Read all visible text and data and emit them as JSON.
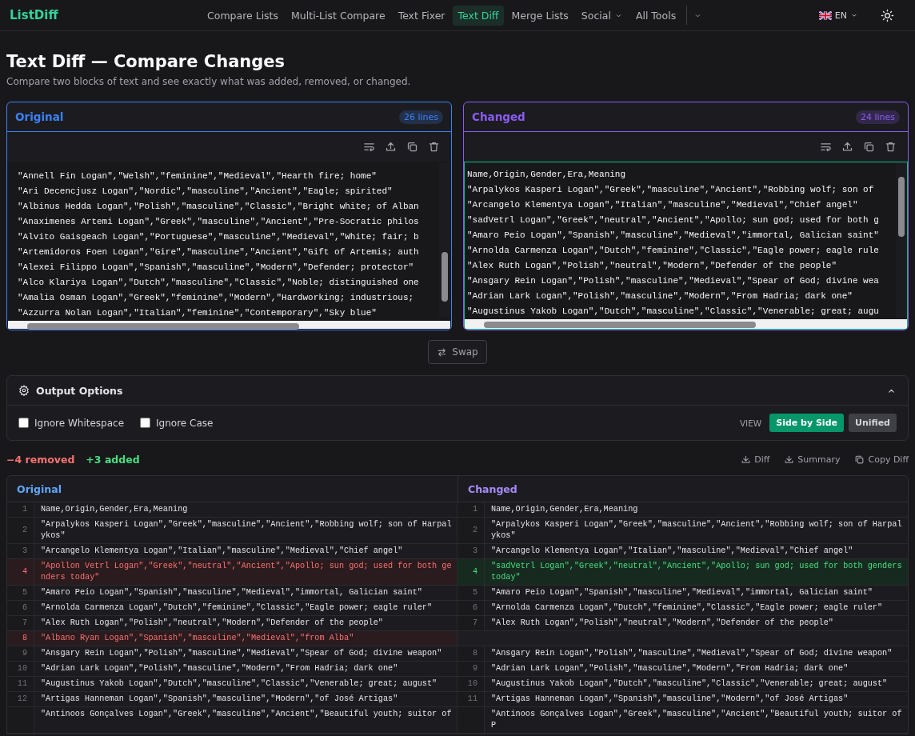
{
  "nav": {
    "brand": "ListDiff",
    "links": [
      {
        "label": "Compare Lists",
        "selected": false,
        "dropdown": false
      },
      {
        "label": "Multi-List Compare",
        "selected": false,
        "dropdown": false
      },
      {
        "label": "Text Fixer",
        "selected": false,
        "dropdown": false
      },
      {
        "label": "Text Diff",
        "selected": true,
        "dropdown": false
      },
      {
        "label": "Merge Lists",
        "selected": false,
        "dropdown": false
      },
      {
        "label": "Social",
        "selected": false,
        "dropdown": true
      },
      {
        "label": "All Tools",
        "selected": false,
        "dropdown": false
      }
    ],
    "language": "EN"
  },
  "page": {
    "title": "Text Diff — Compare Changes",
    "subtitle": "Compare two blocks of text and see exactly what was added, removed, or changed."
  },
  "editors": [
    {
      "title": "Original",
      "count": "26 lines",
      "color": "#3b82f6",
      "focused": false,
      "lines": [
        "\"Annell Fin Logan\",\"Welsh\",\"feminine\",\"Medieval\",\"Hearth fire; home\"",
        "\"Ari Decencjusz Logan\",\"Nordic\",\"masculine\",\"Ancient\",\"Eagle; spirited\"",
        "\"Albinus Hedda Logan\",\"Polish\",\"masculine\",\"Classic\",\"Bright white; of Alban",
        "\"Anaximenes Artemi Logan\",\"Greek\",\"masculine\",\"Ancient\",\"Pre-Socratic philos",
        "\"Alvito Gaisgeach Logan\",\"Portuguese\",\"masculine\",\"Medieval\",\"White; fair; b",
        "\"Artemidoros Foen Logan\",\"Gire\",\"masculine\",\"Ancient\",\"Gift of Artemis; auth",
        "\"Alexei Filippo Logan\",\"Spanish\",\"masculine\",\"Modern\",\"Defender; protector\"",
        "\"Alco Klariya Logan\",\"Dutch\",\"masculine\",\"Classic\",\"Noble; distinguished one",
        "\"Amalia Osman Logan\",\"Greek\",\"feminine\",\"Modern\",\"Hardworking; industrious;",
        "\"Azzurra Nolan Logan\",\"Italian\",\"feminine\",\"Contemporary\",\"Sky blue\""
      ]
    },
    {
      "title": "Changed",
      "count": "24 lines",
      "color": "#8b5cf6",
      "focused": true,
      "lines": [
        "Name,Origin,Gender,Era,Meaning",
        "\"Arpalykos Kasperi Logan\",\"Greek\",\"masculine\",\"Ancient\",\"Robbing wolf; son of",
        "\"Arcangelo Klementya Logan\",\"Italian\",\"masculine\",\"Medieval\",\"Chief angel\"",
        "\"sadVetrl Logan\",\"Greek\",\"neutral\",\"Ancient\",\"Apollo; sun god; used for both g",
        "\"Amaro Peio Logan\",\"Spanish\",\"masculine\",\"Medieval\",\"immortal, Galician saint\"",
        "\"Arnolda Carmenza Logan\",\"Dutch\",\"feminine\",\"Classic\",\"Eagle power; eagle rule",
        "\"Alex Ruth Logan\",\"Polish\",\"neutral\",\"Modern\",\"Defender of the people\"",
        "\"Ansgary Rein Logan\",\"Polish\",\"masculine\",\"Medieval\",\"Spear of God; divine wea",
        "\"Adrian Lark Logan\",\"Polish\",\"masculine\",\"Modern\",\"From Hadria; dark one\"",
        "\"Augustinus Yakob Logan\",\"Dutch\",\"masculine\",\"Classic\",\"Venerable; great; augu"
      ]
    }
  ],
  "swap": "Swap",
  "options": {
    "title": "Output Options",
    "expanded": true,
    "checkboxes": [
      {
        "label": "Ignore Whitespace",
        "checked": false
      },
      {
        "label": "Ignore Case",
        "checked": false
      }
    ],
    "view_label": "VIEW",
    "views": [
      {
        "label": "Side by Side",
        "selected": true
      },
      {
        "label": "Unified",
        "selected": false
      }
    ]
  },
  "summary": {
    "removed": "−4 removed",
    "added": "+3 added",
    "actions": [
      {
        "label": "Diff",
        "kind": "download"
      },
      {
        "label": "Summary",
        "kind": "download"
      },
      {
        "label": "Copy Diff",
        "kind": "copy"
      }
    ]
  },
  "diff": {
    "columns": [
      {
        "title": "Original",
        "color": "#60a5fa"
      },
      {
        "title": "Changed",
        "color": "#a78bfa"
      }
    ],
    "rows": [
      {
        "left": {
          "number": "1",
          "text": "Name,Origin,Gender,Era,Meaning",
          "kind": "same"
        },
        "right": {
          "number": "1",
          "text": "Name,Origin,Gender,Era,Meaning",
          "kind": "same"
        }
      },
      {
        "left": {
          "number": "2",
          "text": "\"Arpalykos Kasperi Logan\",\"Greek\",\"masculine\",\"Ancient\",\"Robbing wolf; son of Harpalykos\"",
          "kind": "same"
        },
        "right": {
          "number": "2",
          "text": "\"Arpalykos Kasperi Logan\",\"Greek\",\"masculine\",\"Ancient\",\"Robbing wolf; son of Harpalykos\"",
          "kind": "same"
        }
      },
      {
        "left": {
          "number": "3",
          "text": "\"Arcangelo Klementya Logan\",\"Italian\",\"masculine\",\"Medieval\",\"Chief angel\"",
          "kind": "same"
        },
        "right": {
          "number": "3",
          "text": "\"Arcangelo Klementya Logan\",\"Italian\",\"masculine\",\"Medieval\",\"Chief angel\"",
          "kind": "same"
        }
      },
      {
        "left": {
          "number": "4",
          "text": "\"Apollon Vetrl Logan\",\"Greek\",\"neutral\",\"Ancient\",\"Apollo; sun god; used for both genders today\"",
          "kind": "removed"
        },
        "right": {
          "number": "4",
          "text": "\"sadVetrl Logan\",\"Greek\",\"neutral\",\"Ancient\",\"Apollo; sun god; used for both genders today\"",
          "kind": "added"
        }
      },
      {
        "left": {
          "number": "5",
          "text": "\"Amaro Peio Logan\",\"Spanish\",\"masculine\",\"Medieval\",\"immortal, Galician saint\"",
          "kind": "same"
        },
        "right": {
          "number": "5",
          "text": "\"Amaro Peio Logan\",\"Spanish\",\"masculine\",\"Medieval\",\"immortal, Galician saint\"",
          "kind": "same"
        }
      },
      {
        "left": {
          "number": "6",
          "text": "\"Arnolda Carmenza Logan\",\"Dutch\",\"feminine\",\"Classic\",\"Eagle power; eagle ruler\"",
          "kind": "same"
        },
        "right": {
          "number": "6",
          "text": "\"Arnolda Carmenza Logan\",\"Dutch\",\"feminine\",\"Classic\",\"Eagle power; eagle ruler\"",
          "kind": "same"
        }
      },
      {
        "left": {
          "number": "7",
          "text": "\"Alex Ruth Logan\",\"Polish\",\"neutral\",\"Modern\",\"Defender of the people\"",
          "kind": "same"
        },
        "right": {
          "number": "7",
          "text": "\"Alex Ruth Logan\",\"Polish\",\"neutral\",\"Modern\",\"Defender of the people\"",
          "kind": "same"
        }
      },
      {
        "left": {
          "number": "8",
          "text": "\"Albano Ryan Logan\",\"Spanish\",\"masculine\",\"Medieval\",\"from Alba\"",
          "kind": "removed"
        },
        "right": {
          "kind": "empty"
        }
      },
      {
        "left": {
          "number": "9",
          "text": "\"Ansgary Rein Logan\",\"Polish\",\"masculine\",\"Medieval\",\"Spear of God; divine weapon\"",
          "kind": "same"
        },
        "right": {
          "number": "8",
          "text": "\"Ansgary Rein Logan\",\"Polish\",\"masculine\",\"Medieval\",\"Spear of God; divine weapon\"",
          "kind": "same"
        }
      },
      {
        "left": {
          "number": "10",
          "text": "\"Adrian Lark Logan\",\"Polish\",\"masculine\",\"Modern\",\"From Hadria; dark one\"",
          "kind": "same"
        },
        "right": {
          "number": "9",
          "text": "\"Adrian Lark Logan\",\"Polish\",\"masculine\",\"Modern\",\"From Hadria; dark one\"",
          "kind": "same"
        }
      },
      {
        "left": {
          "number": "11",
          "text": "\"Augustinus Yakob Logan\",\"Dutch\",\"masculine\",\"Classic\",\"Venerable; great; august\"",
          "kind": "same"
        },
        "right": {
          "number": "10",
          "text": "\"Augustinus Yakob Logan\",\"Dutch\",\"masculine\",\"Classic\",\"Venerable; great; august\"",
          "kind": "same"
        }
      },
      {
        "left": {
          "number": "12",
          "text": "\"Artigas Hanneman Logan\",\"Spanish\",\"masculine\",\"Modern\",\"of José Artigas\"",
          "kind": "same"
        },
        "right": {
          "number": "11",
          "text": "\"Artigas Hanneman Logan\",\"Spanish\",\"masculine\",\"Modern\",\"of José Artigas\"",
          "kind": "same"
        }
      },
      {
        "left": {
          "text": "\"Antinoos Gonçalves Logan\",\"Greek\",\"masculine\",\"Ancient\",\"Beautiful youth; suitor of",
          "kind": "same"
        },
        "right": {
          "text": "\"Antinoos Gonçalves Logan\",\"Greek\",\"masculine\",\"Ancient\",\"Beautiful youth; suitor of P",
          "kind": "same"
        }
      }
    ]
  }
}
